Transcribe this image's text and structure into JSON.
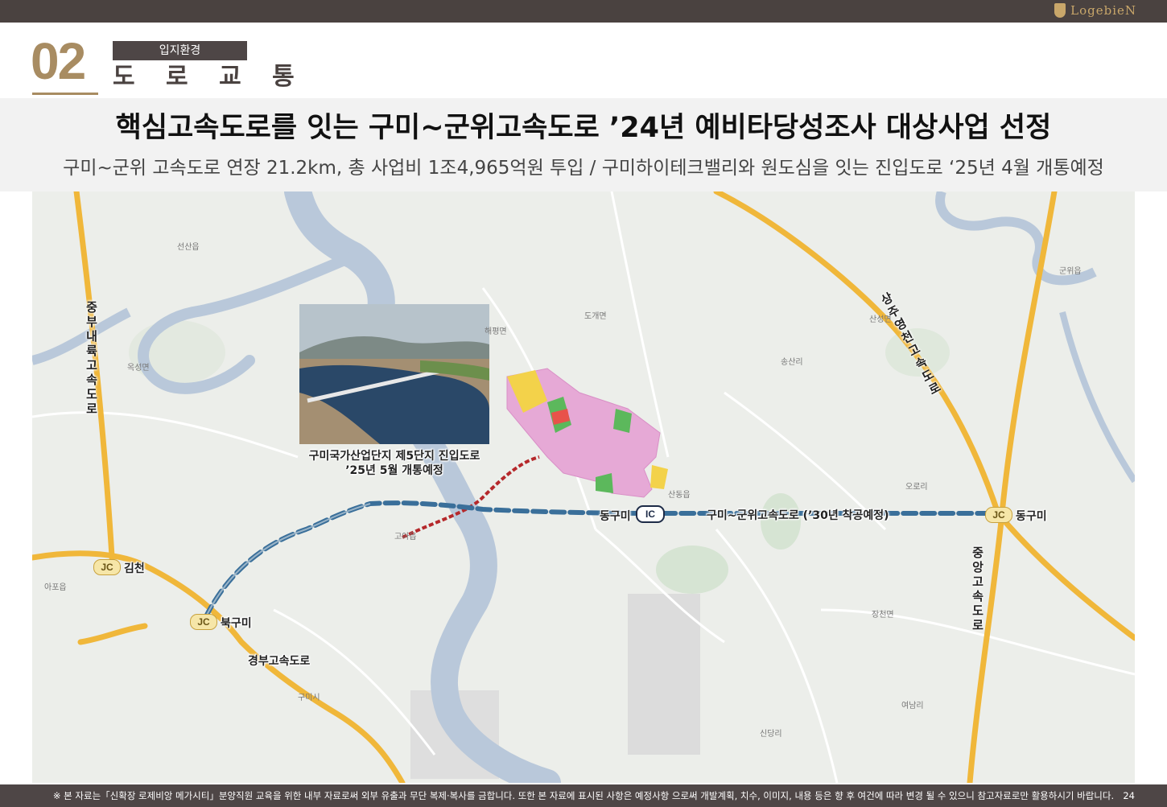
{
  "brand": {
    "name": "LogebieN"
  },
  "section": {
    "number": "02",
    "chip": "입지환경",
    "title": "도 로 교 통"
  },
  "headline": "핵심고속도로를 잇는 구미~군위고속도로 ’24년 예비타당성조사 대상사업 선정",
  "subline": "구미~군위 고속도로 연장 21.2km, 총 사업비 1조4,965억원 투입 / 구미하이테크밸리와 원도심을 잇는 진입도로 ‘25년 4월 개통예정",
  "map": {
    "photo_caption_line1": "구미국가산업단지 제5단지 진입도로",
    "photo_caption_line2": "’25년 5월 개통예정",
    "new_expressway_label": "구미~군위고속도로 (’30년 착공예정)",
    "jc_badge": "JC",
    "ic_badge": "IC",
    "junctions": {
      "gimcheon": "김천",
      "bukgumi": "북구미",
      "donggumi_jc": "동구미",
      "donggumi_ic": "동구미"
    },
    "roads": {
      "jungbu_naeryuk": "중부내륙고속도로",
      "gyeongbu": "경부고속도로",
      "sangju_yeongcheon": "상주영천고속도로",
      "jungang": "중앙고속도로"
    },
    "places": [
      "선산읍",
      "해평면",
      "도개면",
      "장천면",
      "산동읍",
      "아포읍",
      "구미시",
      "군위읍",
      "산성면",
      "송산리",
      "오로리",
      "옥성면",
      "고아읍",
      "장천면",
      "여남리",
      "신당리"
    ],
    "colors": {
      "water": "#b9c8da",
      "highway": "#f0b73a",
      "new_expressway": "#3a6f9a",
      "access_road": "#b5282b",
      "complex_pink": "#e6a9d6",
      "complex_yellow": "#f3d24a",
      "complex_green": "#5cb85c"
    }
  },
  "footer": {
    "notice": "※ 본 자료는「신확장 로제비앙 메가시티」분양직원 교육을 위한 내부 자료로써 외부 유출과 무단 복제·복사를 금합니다. 또한 본 자료에 표시된 사항은 예정사항 으로써 개발계획, 치수, 이미지, 내용 등은 향 후 여건에 따라 변경 될 수 있으니 참고자료로만 활용하시기 바랍니다.",
    "page": "24"
  }
}
